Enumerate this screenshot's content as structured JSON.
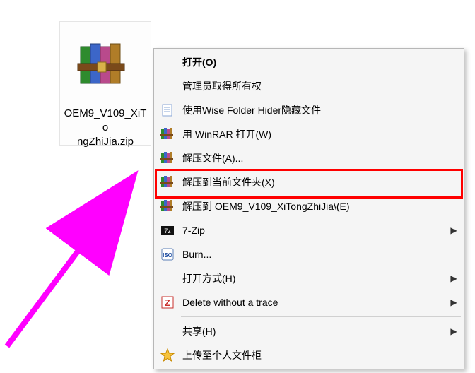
{
  "file": {
    "name": "OEM9_V109_XiTongZhiJia.zip",
    "display_line1": "OEM9_V109_XiTo",
    "display_line2": "ngZhiJia.zip"
  },
  "context_menu": {
    "items": [
      {
        "id": "open",
        "label": "打开(O)",
        "icon": "none",
        "bold": true,
        "submenu": false
      },
      {
        "id": "take-ownership",
        "label": "管理员取得所有权",
        "icon": "none",
        "bold": false,
        "submenu": false
      },
      {
        "id": "wise-hide",
        "label": "使用Wise Folder Hider隐藏文件",
        "icon": "doc",
        "bold": false,
        "submenu": false
      },
      {
        "id": "winrar-open",
        "label": "用 WinRAR 打开(W)",
        "icon": "rar",
        "bold": false,
        "submenu": false
      },
      {
        "id": "extract-files",
        "label": "解压文件(A)...",
        "icon": "rar",
        "bold": false,
        "submenu": false
      },
      {
        "id": "extract-here",
        "label": "解压到当前文件夹(X)",
        "icon": "rar",
        "bold": false,
        "submenu": false,
        "highlighted": true
      },
      {
        "id": "extract-to",
        "label": "解压到 OEM9_V109_XiTongZhiJia\\(E)",
        "icon": "rar",
        "bold": false,
        "submenu": false
      },
      {
        "id": "seven-zip",
        "label": "7-Zip",
        "icon": "7z",
        "bold": false,
        "submenu": true
      },
      {
        "id": "burn",
        "label": "Burn...",
        "icon": "iso",
        "bold": false,
        "submenu": false
      },
      {
        "id": "open-with",
        "label": "打开方式(H)",
        "icon": "none",
        "bold": false,
        "submenu": true
      },
      {
        "id": "delete-trace",
        "label": "Delete without a trace",
        "icon": "z",
        "bold": false,
        "submenu": true
      },
      {
        "separator": true
      },
      {
        "id": "share",
        "label": "共享(H)",
        "icon": "none",
        "bold": false,
        "submenu": true
      },
      {
        "id": "upload-locker",
        "label": "上传至个人文件柜",
        "icon": "star",
        "bold": false,
        "submenu": false
      }
    ]
  },
  "highlight": {
    "item_id": "extract-here"
  },
  "icons": {
    "rar": "winrar-books-icon",
    "doc": "document-icon",
    "7z": "seven-zip-icon",
    "iso": "iso-disc-icon",
    "z": "z-icon",
    "star": "star-icon"
  },
  "colors": {
    "arrow": "#ff00ff",
    "highlight_border": "#ff0000",
    "menu_bg": "#f5f5f5",
    "menu_border": "#b7b7b7"
  }
}
